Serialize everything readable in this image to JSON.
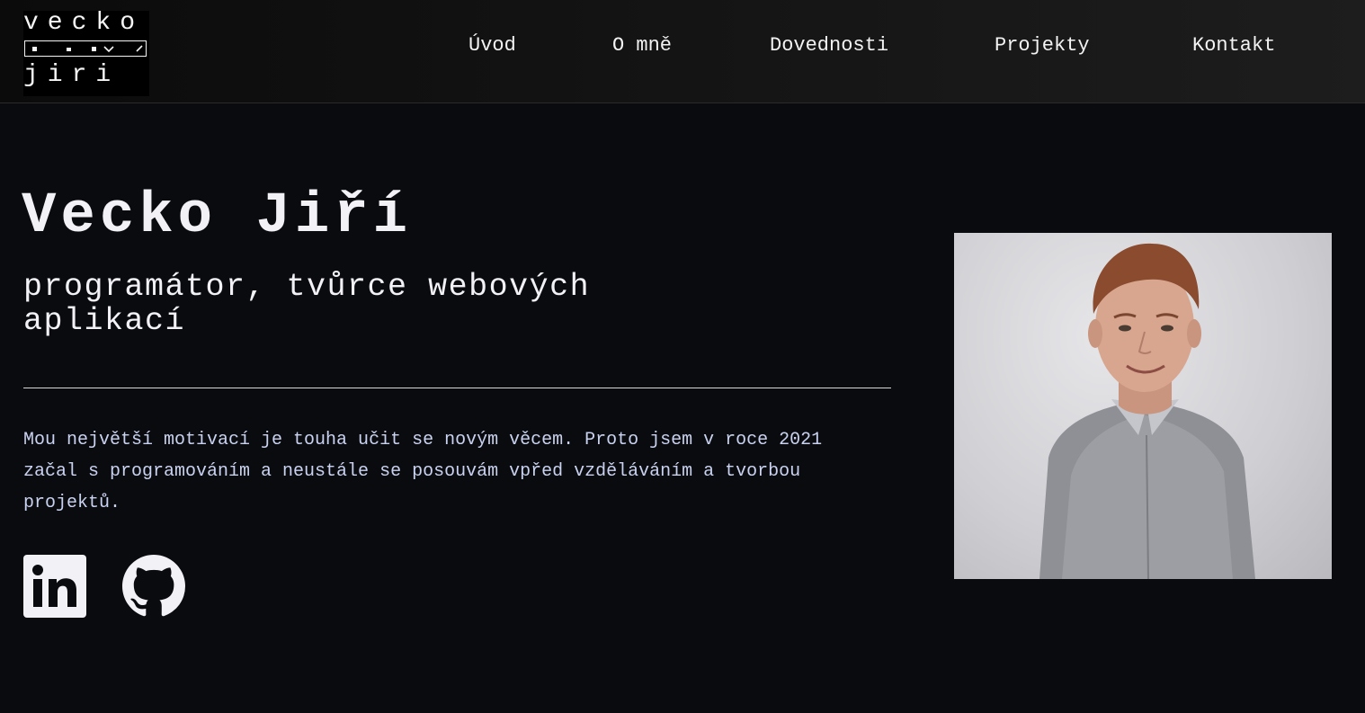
{
  "logo": {
    "top": "vecko",
    "bottom": "jiri"
  },
  "nav": {
    "items": [
      {
        "label": "Úvod"
      },
      {
        "label": "O mně"
      },
      {
        "label": "Dovednosti"
      },
      {
        "label": "Projekty"
      },
      {
        "label": "Kontakt"
      }
    ]
  },
  "hero": {
    "name": "Vecko Jiří",
    "role": "programátor, tvůrce webových aplikací",
    "bio": "Mou největší motivací je touha učit se novým věcem. Proto jsem v roce 2021 začal s programováním a neustále se posouvám vpřed vzděláváním a tvorbou projektů."
  },
  "social": {
    "linkedin_icon": "linkedin-icon",
    "github_icon": "github-icon"
  },
  "colors": {
    "background": "#0a0b0e",
    "text": "#f2f2f6",
    "bio_text": "#c9d2f0"
  }
}
